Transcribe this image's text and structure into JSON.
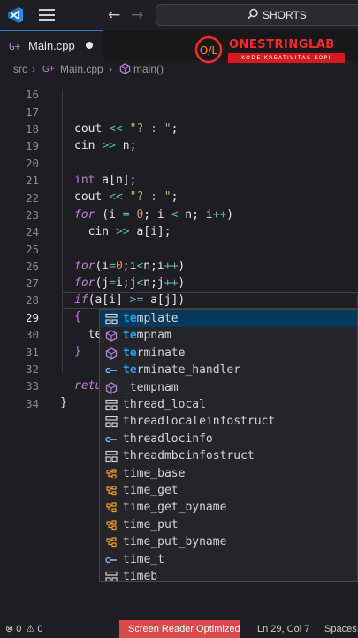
{
  "titlebar": {
    "search_text": "SHORTS",
    "icons": [
      "vscode-logo-icon",
      "menu-icon",
      "back-arrow-icon",
      "forward-arrow-icon",
      "search-icon"
    ]
  },
  "tab": {
    "label": "Main.cpp",
    "file_icon_text": "G+",
    "modified_dot": true
  },
  "brand": {
    "name": "ONESTRINGLAB",
    "tagline": "KODE KREATIVITAS KOPI",
    "logo_text": "O/L"
  },
  "breadcrumb": {
    "folder": "src",
    "file": "Main.cpp",
    "symbol": "main()"
  },
  "editor": {
    "partial_top_line_number": "16",
    "lines": [
      {
        "num": "17",
        "text": "cout << \"? : \";"
      },
      {
        "num": "18",
        "text": "cin >> n;"
      },
      {
        "num": "19",
        "text": ""
      },
      {
        "num": "20",
        "text": "int a[n];"
      },
      {
        "num": "21",
        "text": "cout << \"? : \";"
      },
      {
        "num": "22",
        "text": "for (i = 0; i < n; i++)"
      },
      {
        "num": "23",
        "text": "  cin >> a[i];"
      },
      {
        "num": "24",
        "text": ""
      },
      {
        "num": "25",
        "text": "for(i=0;i<n;i++)"
      },
      {
        "num": "26",
        "text": "for(j=i;j<n;j++)"
      },
      {
        "num": "27",
        "text": "if(a[i] >= a[j])"
      },
      {
        "num": "28",
        "text": "{"
      },
      {
        "num": "29",
        "text": "  te"
      },
      {
        "num": "30",
        "text": "}"
      },
      {
        "num": "31",
        "text": ""
      },
      {
        "num": "32",
        "text": "retu"
      },
      {
        "num": "33",
        "text": "}"
      },
      {
        "num": "34",
        "text": ""
      }
    ],
    "current_line": "29"
  },
  "suggestions": {
    "typed_prefix": "te",
    "items": [
      {
        "label": "template",
        "match": "te",
        "kind": "struct",
        "selected": true
      },
      {
        "label": "tempnam",
        "match": "te",
        "kind": "function"
      },
      {
        "label": "terminate",
        "match": "te",
        "kind": "function"
      },
      {
        "label": "terminate_handler",
        "match": "te",
        "kind": "typedef"
      },
      {
        "label": "_tempnam",
        "match": "",
        "kind": "function"
      },
      {
        "label": "thread_local",
        "match": "",
        "kind": "struct"
      },
      {
        "label": "threadlocaleinfostruct",
        "match": "",
        "kind": "struct"
      },
      {
        "label": "threadlocinfo",
        "match": "",
        "kind": "typedef"
      },
      {
        "label": "threadmbcinfostruct",
        "match": "",
        "kind": "struct"
      },
      {
        "label": "time_base",
        "match": "",
        "kind": "class"
      },
      {
        "label": "time_get",
        "match": "",
        "kind": "class"
      },
      {
        "label": "time_get_byname",
        "match": "",
        "kind": "class"
      },
      {
        "label": "time_put",
        "match": "",
        "kind": "class"
      },
      {
        "label": "time_put_byname",
        "match": "",
        "kind": "class"
      },
      {
        "label": "time_t",
        "match": "",
        "kind": "typedef"
      },
      {
        "label": "timeb",
        "match": "",
        "kind": "struct"
      }
    ]
  },
  "statusbar": {
    "errors": "0",
    "warnings": "0",
    "screen_reader": "Screen Reader Optimized",
    "position": "Ln 29, Col 7",
    "spaces": "Spaces:"
  },
  "colors": {
    "keyword": "#c678dd",
    "operator": "#56b6c2",
    "number": "#d19a66",
    "string": "#98c379",
    "match": "#18a3ff",
    "brand": "#ff2a2a",
    "status_button": "#d94a4a"
  }
}
